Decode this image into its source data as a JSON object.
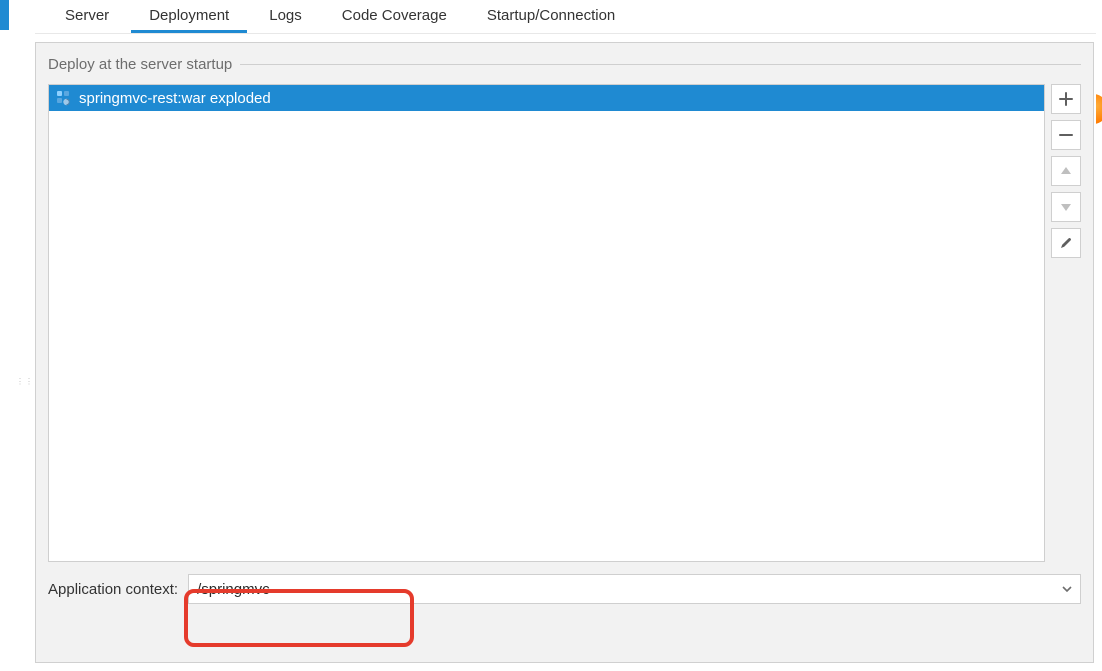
{
  "tabs": {
    "server": "Server",
    "deployment": "Deployment",
    "logs": "Logs",
    "code_coverage": "Code Coverage",
    "startup_connection": "Startup/Connection",
    "active": "deployment"
  },
  "group_title": "Deploy at the server startup",
  "artifacts": {
    "items": [
      {
        "label": "springmvc-rest:war exploded"
      }
    ]
  },
  "side_buttons": {
    "add_tooltip": "Add",
    "remove_tooltip": "Remove",
    "up_tooltip": "Move Up",
    "down_tooltip": "Move Down",
    "edit_tooltip": "Edit"
  },
  "context": {
    "label": "Application context:",
    "value": "/springmvc"
  }
}
